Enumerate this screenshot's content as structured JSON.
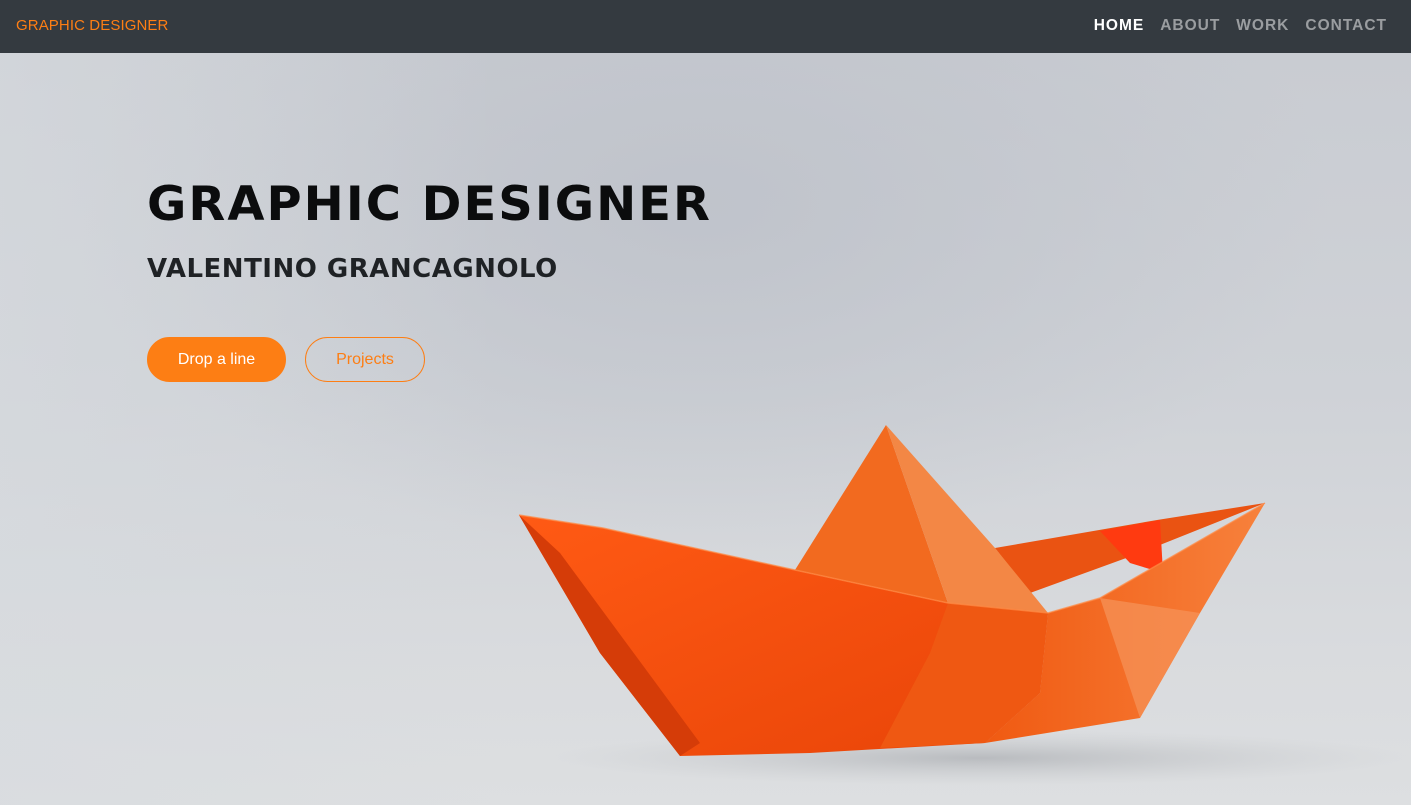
{
  "navbar": {
    "brand": "GRAPHIC DESIGNER",
    "links": [
      {
        "label": "HOME",
        "active": true
      },
      {
        "label": "ABOUT",
        "active": false
      },
      {
        "label": "WORK",
        "active": false
      },
      {
        "label": "CONTACT",
        "active": false
      }
    ]
  },
  "hero": {
    "title": "GRAPHIC DESIGNER",
    "subtitle": "VALENTINO GRANCAGNOLO",
    "primary_button": "Drop a line",
    "secondary_button": "Projects",
    "image": "orange-paper-boat"
  },
  "colors": {
    "accent": "#fd7e14",
    "navbar_bg": "#343a40",
    "text_dark": "#0b0c0d"
  }
}
